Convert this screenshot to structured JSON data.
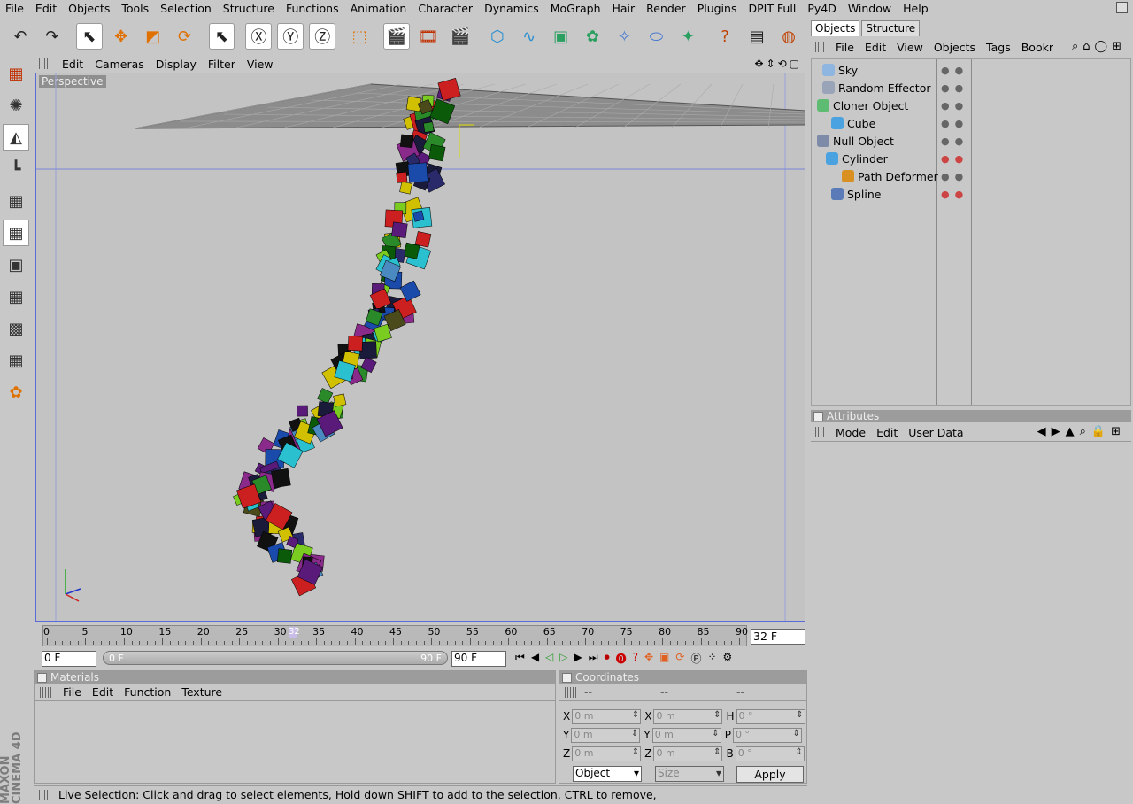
{
  "menubar": [
    "File",
    "Edit",
    "Objects",
    "Tools",
    "Selection",
    "Structure",
    "Functions",
    "Animation",
    "Character",
    "Dynamics",
    "MoGraph",
    "Hair",
    "Render",
    "Plugins",
    "DPIT Full",
    "Py4D",
    "Window",
    "Help"
  ],
  "toolbar_icons": [
    "undo-icon",
    "redo-icon",
    "live-selection-icon",
    "move-icon",
    "scale-icon",
    "rotate-icon",
    "selection-tool-icon",
    "x-axis-icon",
    "y-axis-icon",
    "z-axis-icon",
    "coordinate-system-icon",
    "render-view-icon",
    "render-picture-viewer-icon",
    "render-settings-icon",
    "cube-primitive-icon",
    "spline-icon",
    "nurbs-icon",
    "array-icon",
    "deformer-icon",
    "scene-icon",
    "light-icon",
    "help-icon",
    "content-browser-icon",
    "web-icon"
  ],
  "viewport_menu": [
    "Edit",
    "Cameras",
    "Display",
    "Filter",
    "View"
  ],
  "viewport_label": "Perspective",
  "timeline": {
    "ticks": [
      "0",
      "5",
      "10",
      "15",
      "20",
      "25",
      "30",
      "35",
      "40",
      "45",
      "50",
      "55",
      "60",
      "65",
      "70",
      "75",
      "80",
      "85",
      "90"
    ],
    "current_frame_marker": "32",
    "current_frame": 32,
    "max_frame": 90,
    "current_frame_field": "32 F",
    "start_field": "0 F",
    "slider_start": "0 F",
    "slider_end": "90 F",
    "end_field": "90 F"
  },
  "materials": {
    "title": "Materials",
    "menu": [
      "File",
      "Edit",
      "Function",
      "Texture"
    ]
  },
  "coordinates": {
    "title": "Coordinates",
    "headers": [
      "--",
      "--",
      "--"
    ],
    "rows": [
      {
        "l1": "X",
        "v1": "0 m",
        "l2": "X",
        "v2": "0 m",
        "l3": "H",
        "v3": "0 °"
      },
      {
        "l1": "Y",
        "v1": "0 m",
        "l2": "Y",
        "v2": "0 m",
        "l3": "P",
        "v3": "0 °"
      },
      {
        "l1": "Z",
        "v1": "0 m",
        "l2": "Z",
        "v2": "0 m",
        "l3": "B",
        "v3": "0 °"
      }
    ],
    "mode_select": "Object",
    "size_select": "Size",
    "apply_label": "Apply"
  },
  "status": "Live Selection: Click and drag to select elements, Hold down SHIFT to add to the selection, CTRL to remove,",
  "brand": [
    "MAXON",
    "CINEMA 4D"
  ],
  "objects_panel": {
    "tabs": [
      "Objects",
      "Structure"
    ],
    "menu": [
      "File",
      "Edit",
      "View",
      "Objects",
      "Tags",
      "Bookr"
    ],
    "items": [
      {
        "name": "Sky",
        "color": "#8fb6e0"
      },
      {
        "name": "Random Effector",
        "color": "#9aa4b8"
      },
      {
        "name": "Cloner Object",
        "color": "#5dbb72"
      },
      {
        "name": "Cube",
        "color": "#4aa3e0"
      },
      {
        "name": "Null Object",
        "color": "#7d8aa8"
      },
      {
        "name": "Cylinder",
        "color": "#4aa3e0"
      },
      {
        "name": "Path Deformer",
        "color": "#d89020"
      },
      {
        "name": "Spline",
        "color": "#5a7ab8"
      }
    ]
  },
  "attributes": {
    "title": "Attributes",
    "menu": [
      "Mode",
      "Edit",
      "User Data"
    ]
  }
}
